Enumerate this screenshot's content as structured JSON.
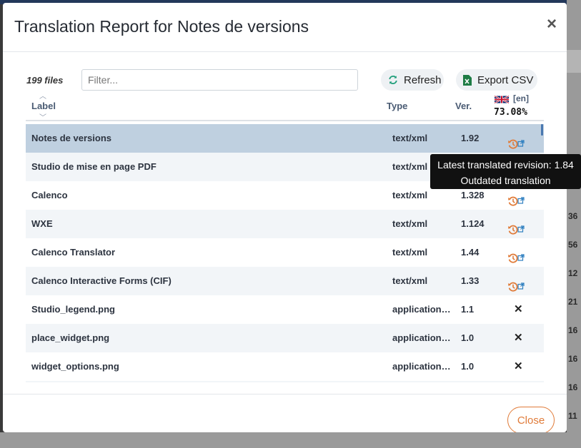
{
  "background": {
    "right_numbers": [
      "36",
      "56",
      "12",
      "21",
      "16",
      "16",
      "16",
      "11"
    ]
  },
  "dialog": {
    "title": "Translation Report for Notes de versions",
    "close_symbol": "×",
    "files_count": "199 files",
    "filter_placeholder": "Filter...",
    "refresh_label": "Refresh",
    "export_label": "Export CSV",
    "close_label": "Close"
  },
  "table": {
    "headers": {
      "label": "Label",
      "type": "Type",
      "version": "Ver."
    },
    "language": {
      "code": "[en]",
      "percent": "73.08%",
      "flag": "uk-flag-icon"
    },
    "rows": [
      {
        "label": "Notes de versions",
        "type": "text/xml",
        "version": "1.92",
        "status": "outdated"
      },
      {
        "label": "Studio de mise en page PDF",
        "type": "text/xml",
        "version": "",
        "status": ""
      },
      {
        "label": "Calenco",
        "type": "text/xml",
        "version": "1.328",
        "status": "outdated"
      },
      {
        "label": "WXE",
        "type": "text/xml",
        "version": "1.124",
        "status": "outdated"
      },
      {
        "label": "Calenco Translator",
        "type": "text/xml",
        "version": "1.44",
        "status": "outdated"
      },
      {
        "label": "Calenco Interactive Forms (CIF)",
        "type": "text/xml",
        "version": "1.33",
        "status": "outdated"
      },
      {
        "label": "Studio_legend.png",
        "type": "application/o...",
        "version": "1.1",
        "status": "missing"
      },
      {
        "label": "place_widget.png",
        "type": "application/o...",
        "version": "1.0",
        "status": "missing"
      },
      {
        "label": "widget_options.png",
        "type": "application/o...",
        "version": "1.0",
        "status": "missing"
      }
    ]
  },
  "tooltip": {
    "line1": "Latest translated revision: 1.84",
    "line2": "Outdated translation"
  },
  "colors": {
    "accent": "#e07b39",
    "selected_row": "#bfd0e0",
    "header_text": "#4a5b73"
  }
}
